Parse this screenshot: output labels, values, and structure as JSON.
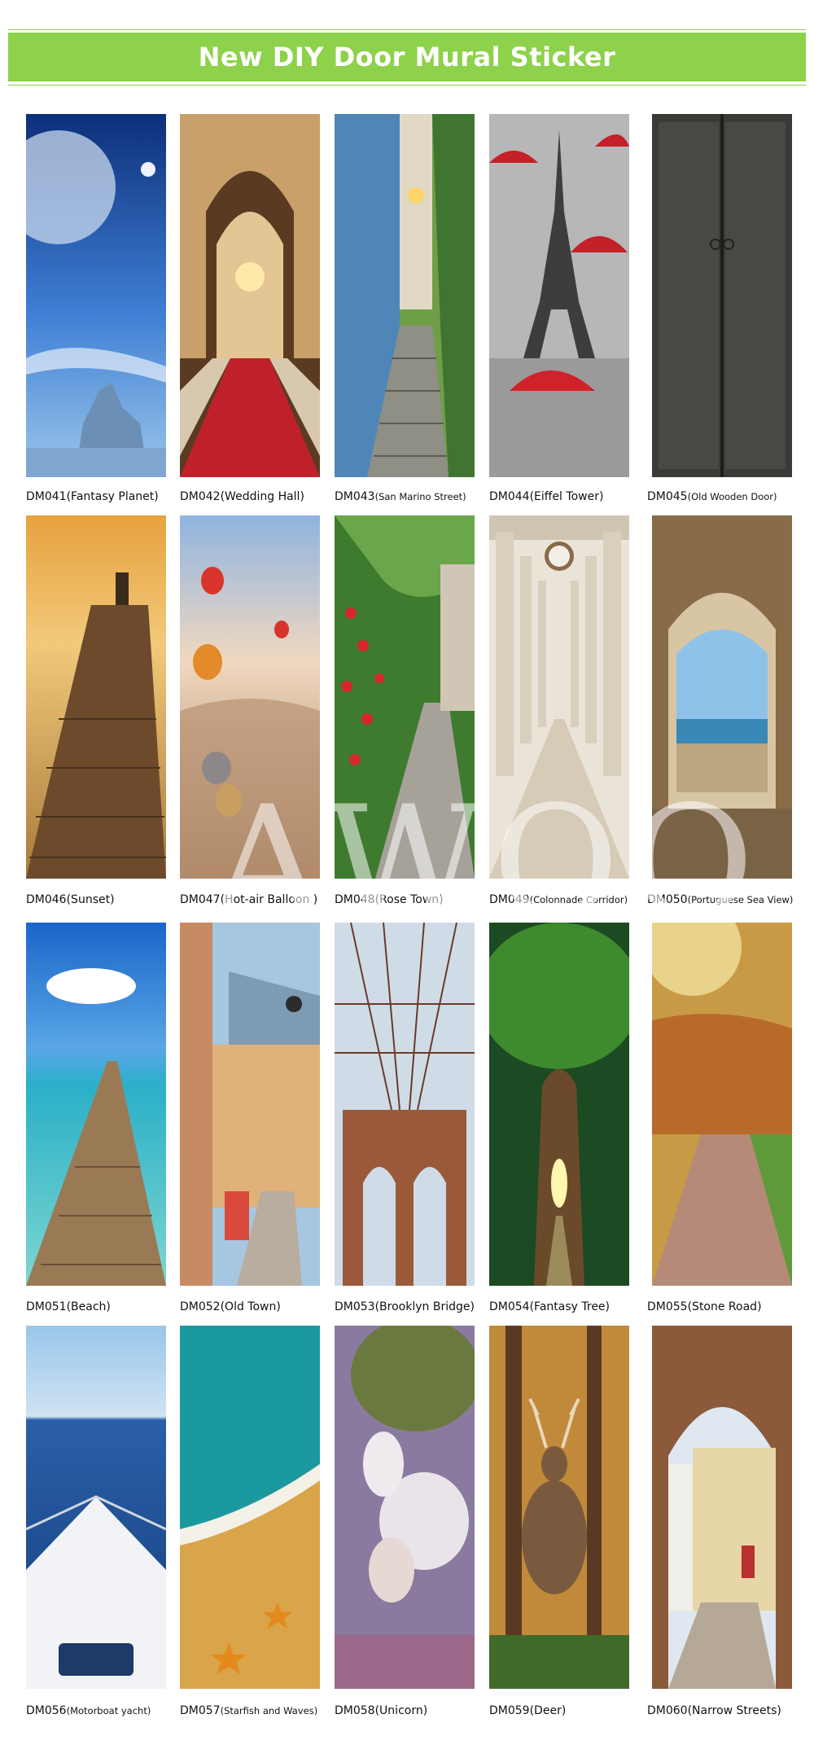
{
  "banner": {
    "title": "New DIY Door Mural Sticker",
    "color": "#8ed14a"
  },
  "watermark": "AWOO",
  "items": [
    {
      "code": "DM041",
      "name": "(Fantasy Planet)",
      "small": false
    },
    {
      "code": "DM042",
      "name": "(Wedding Hall)",
      "small": false
    },
    {
      "code": "DM043",
      "name": "(San Marino Street)",
      "small": true
    },
    {
      "code": "DM044",
      "name": "(Eiffel Tower)",
      "small": false
    },
    {
      "code": "DM045",
      "name": "(Old Wooden Door)",
      "small": true
    },
    {
      "code": "DM046",
      "name": "(Sunset)",
      "small": false
    },
    {
      "code": "DM047",
      "name": "(Hot-air Balloon )",
      "small": false
    },
    {
      "code": "DM048",
      "name": "(Rose Town)",
      "small": false
    },
    {
      "code": "DM049",
      "name": "(Colonnade Corridor)",
      "small": true
    },
    {
      "code": "DM050",
      "name": "(Portuguese Sea View)",
      "small": true
    },
    {
      "code": "DM051",
      "name": "(Beach)",
      "small": false
    },
    {
      "code": "DM052",
      "name": "(Old Town)",
      "small": false
    },
    {
      "code": "DM053",
      "name": "(Brooklyn Bridge)",
      "small": false
    },
    {
      "code": "DM054",
      "name": "(Fantasy Tree)",
      "small": false
    },
    {
      "code": "DM055",
      "name": "(Stone Road)",
      "small": false
    },
    {
      "code": "DM056",
      "name": "(Motorboat yacht)",
      "small": true
    },
    {
      "code": "DM057",
      "name": "(Starfish and Waves)",
      "small": true
    },
    {
      "code": "DM058",
      "name": "(Unicorn)",
      "small": false
    },
    {
      "code": "DM059",
      "name": "(Deer)",
      "small": false
    },
    {
      "code": "DM060",
      "name": "(Narrow Streets)",
      "small": false
    }
  ]
}
